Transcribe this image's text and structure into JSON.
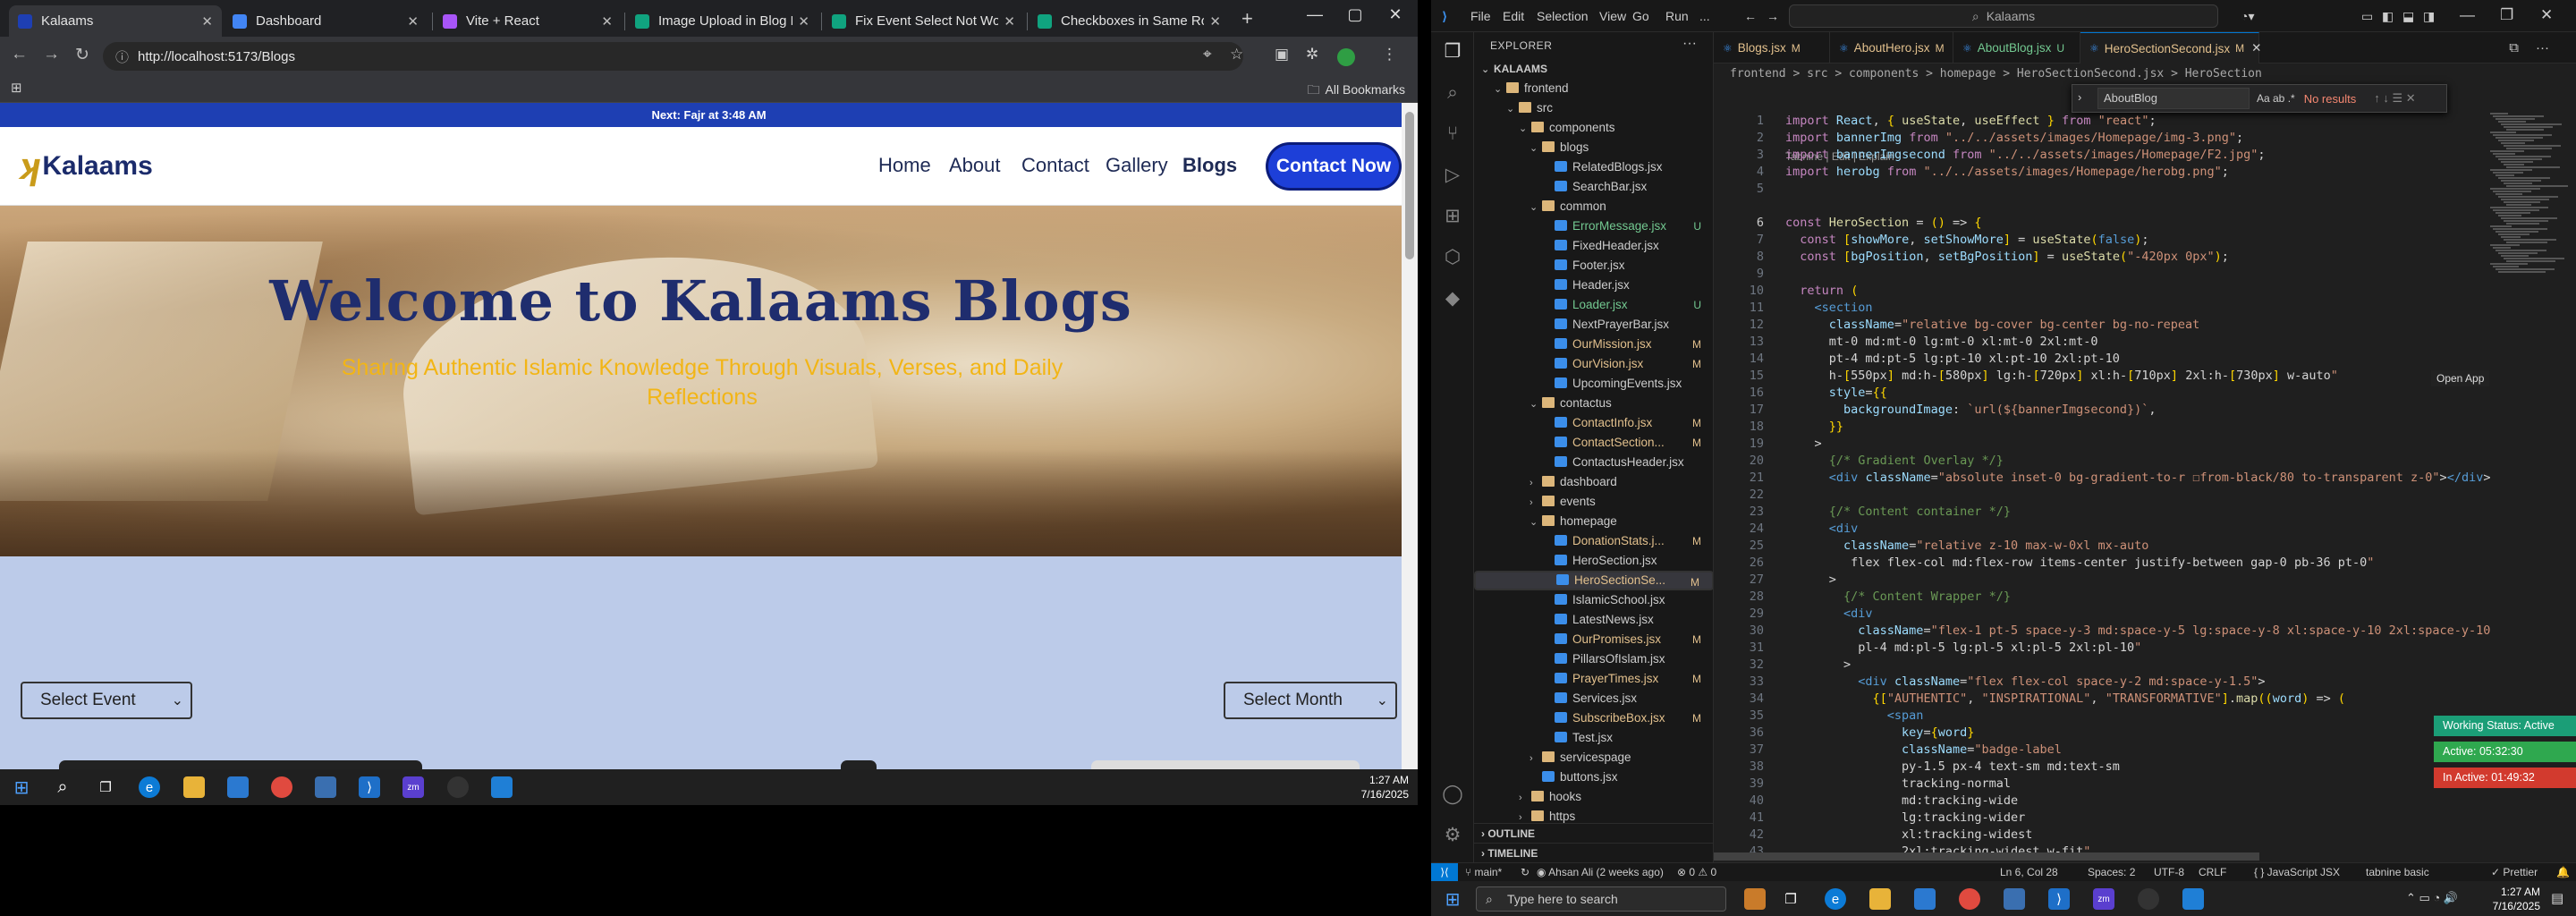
{
  "chrome": {
    "tabs": [
      {
        "title": "Kalaams",
        "active": true,
        "favicon_color": "#1e3fb3"
      },
      {
        "title": "Dashboard",
        "active": false,
        "favicon_color": "#4285f4"
      },
      {
        "title": "Vite + React",
        "active": false,
        "favicon_color": "#a855f7"
      },
      {
        "title": "Image Upload in Blog Editor",
        "active": false,
        "favicon_color": "#10a37f"
      },
      {
        "title": "Fix Event Select Not Working",
        "active": false,
        "favicon_color": "#10a37f"
      },
      {
        "title": "Checkboxes in Same Row",
        "active": false,
        "favicon_color": "#10a37f"
      }
    ],
    "url": "http://localhost:5173/Blogs",
    "all_bookmarks": "All Bookmarks"
  },
  "site": {
    "announcement": "Next: Fajr at 3:48 AM",
    "logo_text": "Kalaams",
    "nav": [
      "Home",
      "About",
      "Contact",
      "Gallery",
      "Blogs"
    ],
    "contact_button": "Contact Now",
    "hero_title": "Welcome to Kalaams Blogs",
    "hero_subtitle": "Sharing Authentic Islamic Knowledge Through Visuals, Verses, and Daily Reflections",
    "select_event": "Select Event",
    "select_month": "Select Month",
    "colors": {
      "primary": "#1d3fd8",
      "accent": "#f2b516",
      "navy": "#1f2d6e",
      "bg_lower": "#bccbe9"
    }
  },
  "left_taskbar": {
    "time": "1:27 AM",
    "date": "7/16/2025"
  },
  "vscode": {
    "menu": [
      "File",
      "Edit",
      "Selection",
      "View",
      "Go",
      "Run",
      "..."
    ],
    "command_center": "Kalaams",
    "explorer_title": "EXPLORER",
    "tree": [
      {
        "name": "KALAAMS",
        "depth": 0,
        "kind": "root",
        "open": true
      },
      {
        "name": "frontend",
        "depth": 1,
        "kind": "folder",
        "open": true
      },
      {
        "name": "src",
        "depth": 2,
        "kind": "folder",
        "open": true
      },
      {
        "name": "components",
        "depth": 3,
        "kind": "folder",
        "open": true
      },
      {
        "name": "blogs",
        "depth": 4,
        "kind": "folder",
        "open": true
      },
      {
        "name": "RelatedBlogs.jsx",
        "depth": 5,
        "kind": "js",
        "status": ""
      },
      {
        "name": "SearchBar.jsx",
        "depth": 5,
        "kind": "js",
        "status": ""
      },
      {
        "name": "common",
        "depth": 4,
        "kind": "folder",
        "open": true
      },
      {
        "name": "ErrorMessage.jsx",
        "depth": 5,
        "kind": "js",
        "status": "U"
      },
      {
        "name": "FixedHeader.jsx",
        "depth": 5,
        "kind": "js",
        "status": ""
      },
      {
        "name": "Footer.jsx",
        "depth": 5,
        "kind": "js",
        "status": ""
      },
      {
        "name": "Header.jsx",
        "depth": 5,
        "kind": "js",
        "status": ""
      },
      {
        "name": "Loader.jsx",
        "depth": 5,
        "kind": "js",
        "status": "U"
      },
      {
        "name": "NextPrayerBar.jsx",
        "depth": 5,
        "kind": "js",
        "status": ""
      },
      {
        "name": "OurMission.jsx",
        "depth": 5,
        "kind": "js",
        "status": "M"
      },
      {
        "name": "OurVision.jsx",
        "depth": 5,
        "kind": "js",
        "status": "M"
      },
      {
        "name": "UpcomingEvents.jsx",
        "depth": 5,
        "kind": "js",
        "status": ""
      },
      {
        "name": "contactus",
        "depth": 4,
        "kind": "folder",
        "open": true
      },
      {
        "name": "ContactInfo.jsx",
        "depth": 5,
        "kind": "js",
        "status": "M"
      },
      {
        "name": "ContactSection...",
        "depth": 5,
        "kind": "js",
        "status": "M"
      },
      {
        "name": "ContactusHeader.jsx",
        "depth": 5,
        "kind": "js",
        "status": ""
      },
      {
        "name": "dashboard",
        "depth": 4,
        "kind": "folder",
        "open": false
      },
      {
        "name": "events",
        "depth": 4,
        "kind": "folder",
        "open": false
      },
      {
        "name": "homepage",
        "depth": 4,
        "kind": "folder",
        "open": true
      },
      {
        "name": "DonationStats.j...",
        "depth": 5,
        "kind": "js",
        "status": "M"
      },
      {
        "name": "HeroSection.jsx",
        "depth": 5,
        "kind": "js",
        "status": ""
      },
      {
        "name": "HeroSectionSe...",
        "depth": 5,
        "kind": "js",
        "status": "M",
        "selected": true
      },
      {
        "name": "IslamicSchool.jsx",
        "depth": 5,
        "kind": "js",
        "status": ""
      },
      {
        "name": "LatestNews.jsx",
        "depth": 5,
        "kind": "js",
        "status": ""
      },
      {
        "name": "OurPromises.jsx",
        "depth": 5,
        "kind": "js",
        "status": "M"
      },
      {
        "name": "PillarsOfIslam.jsx",
        "depth": 5,
        "kind": "js",
        "status": ""
      },
      {
        "name": "PrayerTimes.jsx",
        "depth": 5,
        "kind": "js",
        "status": "M"
      },
      {
        "name": "Services.jsx",
        "depth": 5,
        "kind": "js",
        "status": ""
      },
      {
        "name": "SubscribeBox.jsx",
        "depth": 5,
        "kind": "js",
        "status": "M"
      },
      {
        "name": "Test.jsx",
        "depth": 5,
        "kind": "js",
        "status": ""
      },
      {
        "name": "servicespage",
        "depth": 4,
        "kind": "folder",
        "open": false
      },
      {
        "name": "buttons.jsx",
        "depth": 4,
        "kind": "js",
        "status": ""
      },
      {
        "name": "hooks",
        "depth": 3,
        "kind": "folder",
        "open": false
      },
      {
        "name": "https",
        "depth": 3,
        "kind": "folder",
        "open": false
      }
    ],
    "outline": "OUTLINE",
    "timeline": "TIMELINE",
    "editor_tabs": [
      {
        "name": "Blogs.jsx",
        "status": "M",
        "active": false
      },
      {
        "name": "AboutHero.jsx",
        "status": "M",
        "active": false
      },
      {
        "name": "AboutBlog.jsx",
        "status": "U",
        "active": false
      },
      {
        "name": "HeroSectionSecond.jsx",
        "status": "M",
        "active": true
      }
    ],
    "breadcrumb": "frontend > src > components > homepage > HeroSectionSecond.jsx > HeroSection",
    "find_query": "AboutBlog",
    "find_options": "Aa  ab  .*",
    "find_result": "No results",
    "codelens": "Tabnine | Edit | Explain",
    "lines": [
      {
        "n": 1,
        "t": "import React, { useState, useEffect } from \"react\";"
      },
      {
        "n": 2,
        "t": "import bannerImg from \"../../assets/images/Homepage/img-3.png\";"
      },
      {
        "n": 3,
        "t": "import bannerImgsecond from \"../../assets/images/Homepage/F2.jpg\";"
      },
      {
        "n": 4,
        "t": "import herobg from \"../../assets/images/Homepage/herobg.png\";"
      },
      {
        "n": 5,
        "t": ""
      },
      {
        "n": 6,
        "t": "const HeroSection = () => {"
      },
      {
        "n": 7,
        "t": "  const [showMore, setShowMore] = useState(false);"
      },
      {
        "n": 8,
        "t": "  const [bgPosition, setBgPosition] = useState(\"-420px 0px\");"
      },
      {
        "n": 9,
        "t": ""
      },
      {
        "n": 10,
        "t": "  return ("
      },
      {
        "n": 11,
        "t": "    <section"
      },
      {
        "n": 12,
        "t": "      className=\"relative bg-cover bg-center bg-no-repeat"
      },
      {
        "n": 13,
        "t": "      mt-0 md:mt-0 lg:mt-0 xl:mt-0 2xl:mt-0"
      },
      {
        "n": 14,
        "t": "      pt-4 md:pt-5 lg:pt-10 xl:pt-10 2xl:pt-10"
      },
      {
        "n": 15,
        "t": "      h-[550px] md:h-[580px] lg:h-[720px] xl:h-[710px] 2xl:h-[730px] w-auto\""
      },
      {
        "n": 16,
        "t": "      style={{"
      },
      {
        "n": 17,
        "t": "        backgroundImage: `url(${bannerImgsecond})`,"
      },
      {
        "n": 18,
        "t": "      }}"
      },
      {
        "n": 19,
        "t": "    >"
      },
      {
        "n": 20,
        "t": "      {/* Gradient Overlay */}"
      },
      {
        "n": 21,
        "t": "      <div className=\"absolute inset-0 bg-gradient-to-r ☐from-black/80 to-transparent z-0\"></div>"
      },
      {
        "n": 22,
        "t": ""
      },
      {
        "n": 23,
        "t": "      {/* Content container */}"
      },
      {
        "n": 24,
        "t": "      <div"
      },
      {
        "n": 25,
        "t": "        className=\"relative z-10 max-w-0xl mx-auto"
      },
      {
        "n": 26,
        "t": "         flex flex-col md:flex-row items-center justify-between gap-0 pb-36 pt-0\""
      },
      {
        "n": 27,
        "t": "      >"
      },
      {
        "n": 28,
        "t": "        {/* Content Wrapper */}"
      },
      {
        "n": 29,
        "t": "        <div"
      },
      {
        "n": 30,
        "t": "          className=\"flex-1 pt-5 space-y-3 md:space-y-5 lg:space-y-8 xl:space-y-10 2xl:space-y-10"
      },
      {
        "n": 31,
        "t": "          pl-4 md:pl-5 lg:pl-5 xl:pl-5 2xl:pl-10\""
      },
      {
        "n": 32,
        "t": "        >"
      },
      {
        "n": 33,
        "t": "          <div className=\"flex flex-col space-y-2 md:space-y-1.5\">"
      },
      {
        "n": 34,
        "t": "            {[\"AUTHENTIC\", \"INSPIRATIONAL\", \"TRANSFORMATIVE\"].map((word) => ("
      },
      {
        "n": 35,
        "t": "              <span"
      },
      {
        "n": 36,
        "t": "                key={word}"
      },
      {
        "n": 37,
        "t": "                className=\"badge-label"
      },
      {
        "n": 38,
        "t": "                py-1.5 px-4 text-sm md:text-sm"
      },
      {
        "n": 39,
        "t": "                tracking-normal"
      },
      {
        "n": 40,
        "t": "                md:tracking-wide"
      },
      {
        "n": 41,
        "t": "                lg:tracking-wider"
      },
      {
        "n": 42,
        "t": "                xl:tracking-widest"
      },
      {
        "n": 43,
        "t": "                2xl:tracking-widest w-fit\""
      }
    ],
    "wakatime": {
      "working": "Working Status: Active",
      "active": "Active: 05:32:30",
      "inactive": "In Active: 01:49:32"
    },
    "open_app": "Open App",
    "status": {
      "branch": "main*",
      "blame": "Ahsan Ali (2 weeks ago)",
      "problems": "⊗ 0 ⚠ 0",
      "position": "Ln 6, Col 28",
      "spaces": "Spaces: 2",
      "encoding": "UTF-8",
      "eol": "CRLF",
      "language": "{ } JavaScript JSX",
      "tabnine": "tabnine basic",
      "prettier": "✓ Prettier"
    }
  },
  "right_taskbar": {
    "search_placeholder": "Type here to search",
    "time": "1:27 AM",
    "date": "7/16/2025"
  }
}
